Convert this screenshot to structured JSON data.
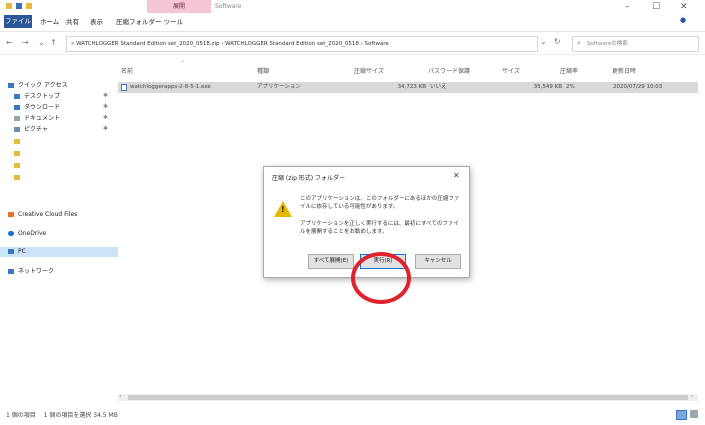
{
  "ribbon": {
    "tabs": [
      "ファイル",
      "ホーム",
      "共有",
      "表示",
      "圧縮フォルダー ツール"
    ],
    "manage_label": "展開",
    "app_title": "Software"
  },
  "window_controls": [
    "–",
    "☐",
    "✕"
  ],
  "address": {
    "path": "« WATCHLOGGER Standard Edition set_2020_0518.zip  ›  WATCHLOGGER Standard Edition set_2020_0518  ›  Software",
    "search_placeholder": "Softwareの検索"
  },
  "nav": {
    "quick_access": "クイック アクセス",
    "items": [
      {
        "label": "デスクトップ",
        "icon": "desktop-icon"
      },
      {
        "label": "ダウンロード",
        "icon": "download-icon"
      },
      {
        "label": "ドキュメント",
        "icon": "document-icon"
      },
      {
        "label": "ピクチャ",
        "icon": "picture-icon"
      },
      {
        "label": "",
        "icon": "folder-icon"
      },
      {
        "label": "",
        "icon": "folder-icon"
      },
      {
        "label": "",
        "icon": "folder-icon"
      },
      {
        "label": "",
        "icon": "folder-icon"
      }
    ],
    "creative_cloud": "Creative Cloud Files",
    "onedrive": "OneDrive",
    "pc": "PC",
    "network": "ネットワーク"
  },
  "columns": [
    "名前",
    "種類",
    "圧縮サイズ",
    "パスワード保護",
    "サイズ",
    "圧縮率",
    "更新日時"
  ],
  "file": {
    "name": "watchloggerapps-2-8-5-1.exe",
    "type": "アプリケーション",
    "compressed": "34,723 KB",
    "password": "いいえ",
    "size": "35,549 KB",
    "ratio": "2%",
    "date": "2020/07/29 10:03"
  },
  "status": "1 個の項目　 1 個の項目を選択  34.5 MB",
  "dialog": {
    "title": "圧縮 (zip 形式) フォルダー",
    "message1": "このアプリケーションは、このフォルダーにあるほかの圧縮ファイルに依存している可能性があります。",
    "message2": "アプリケーションを正しく実行するには、最初にすべてのファイルを展開することをお勧めします。",
    "buttons": [
      "すべて展開(E)",
      "実行(R)",
      "キャンセル"
    ]
  },
  "colors": {
    "accent": "#2b5797",
    "manage_band": "#f5c6d6",
    "selection": "#cce4f7",
    "annotation": "#e0222d"
  }
}
